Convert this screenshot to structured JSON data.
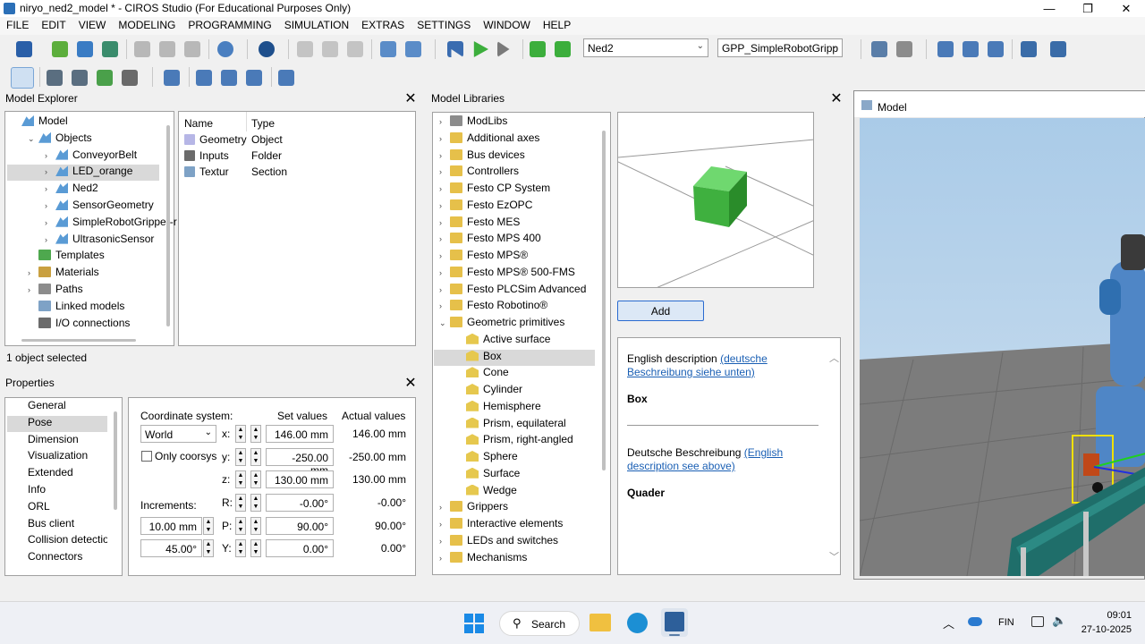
{
  "window": {
    "title": "niryo_ned2_model * - CIROS Studio (For Educational Purposes Only)",
    "min_symbol": "—",
    "max_symbol": "❐",
    "close_symbol": "✕"
  },
  "menu": [
    "FILE",
    "EDIT",
    "VIEW",
    "MODELING",
    "PROGRAMMING",
    "SIMULATION",
    "EXTRAS",
    "SETTINGS",
    "WINDOW",
    "HELP"
  ],
  "toolbar": {
    "robot_combo": "Ned2",
    "gripper_combo": "GPP_SimpleRobotGripp"
  },
  "model_explorer": {
    "title": "Model Explorer",
    "tree": [
      {
        "label": "Model",
        "icon": "model-icon",
        "level": 0,
        "expander": ""
      },
      {
        "label": "Objects",
        "icon": "objects-icon",
        "level": 1,
        "expander": "⌄"
      },
      {
        "label": "ConveyorBelt",
        "icon": "object-icon",
        "level": 2,
        "expander": "›"
      },
      {
        "label": "LED_orange",
        "icon": "object-icon",
        "level": 2,
        "expander": "›",
        "selected": true
      },
      {
        "label": "Ned2",
        "icon": "object-icon",
        "level": 2,
        "expander": "›"
      },
      {
        "label": "SensorGeometry",
        "icon": "object-icon",
        "level": 2,
        "expander": "›"
      },
      {
        "label": "SimpleRobotGripper-r",
        "icon": "object-icon",
        "level": 2,
        "expander": "›"
      },
      {
        "label": "UltrasonicSensor",
        "icon": "object-icon",
        "level": 2,
        "expander": "›"
      },
      {
        "label": "Templates",
        "icon": "templates-icon",
        "level": 1,
        "expander": ""
      },
      {
        "label": "Materials",
        "icon": "materials-icon",
        "level": 1,
        "expander": "›"
      },
      {
        "label": "Paths",
        "icon": "paths-icon",
        "level": 1,
        "expander": "›"
      },
      {
        "label": "Linked models",
        "icon": "linked-models-icon",
        "level": 1,
        "expander": ""
      },
      {
        "label": "I/O connections",
        "icon": "io-connections-icon",
        "level": 1,
        "expander": ""
      }
    ],
    "columns": [
      "Name",
      "Type"
    ],
    "rows": [
      {
        "name": "Geometry",
        "type": "Object"
      },
      {
        "name": "Inputs",
        "type": "Folder"
      },
      {
        "name": "Textur",
        "type": "Section"
      }
    ],
    "status": "1 object selected"
  },
  "properties": {
    "title": "Properties",
    "categories": [
      "General",
      "Pose",
      "Dimension",
      "Visualization",
      "Extended",
      "Info",
      "ORL",
      "Bus client",
      "Collision detection",
      "Connectors"
    ],
    "selected_category": "Pose",
    "coord_label": "Coordinate system:",
    "coord_value": "World",
    "only_coorsys": "Only coorsys",
    "set_values_header": "Set values",
    "actual_values_header": "Actual values",
    "increments_label": "Increments:",
    "inc_length": "10.00 mm",
    "inc_angle": "45.00°",
    "rows": [
      {
        "axis": "x:",
        "set": "146.00 mm",
        "actual": "146.00 mm"
      },
      {
        "axis": "y:",
        "set": "-250.00 mm",
        "actual": "-250.00 mm"
      },
      {
        "axis": "z:",
        "set": "130.00 mm",
        "actual": "130.00 mm"
      },
      {
        "axis": "R:",
        "set": "-0.00°",
        "actual": "-0.00°"
      },
      {
        "axis": "P:",
        "set": "90.00°",
        "actual": "90.00°"
      },
      {
        "axis": "Y:",
        "set": "0.00°",
        "actual": "0.00°"
      }
    ]
  },
  "model_libraries": {
    "title": "Model Libraries",
    "items": [
      {
        "label": "ModLibs",
        "level": 0,
        "expander": "›",
        "icon": "folder-icon"
      },
      {
        "label": "Additional axes",
        "level": 0,
        "expander": "›",
        "icon": "library-icon"
      },
      {
        "label": "Bus devices",
        "level": 0,
        "expander": "›",
        "icon": "library-icon"
      },
      {
        "label": "Controllers",
        "level": 0,
        "expander": "›",
        "icon": "library-icon"
      },
      {
        "label": "Festo CP System",
        "level": 0,
        "expander": "›",
        "icon": "library-icon"
      },
      {
        "label": "Festo EzOPC",
        "level": 0,
        "expander": "›",
        "icon": "library-icon"
      },
      {
        "label": "Festo MES",
        "level": 0,
        "expander": "›",
        "icon": "library-icon"
      },
      {
        "label": "Festo MPS 400",
        "level": 0,
        "expander": "›",
        "icon": "library-icon"
      },
      {
        "label": "Festo MPS®",
        "level": 0,
        "expander": "›",
        "icon": "library-icon"
      },
      {
        "label": "Festo MPS® 500-FMS",
        "level": 0,
        "expander": "›",
        "icon": "library-icon"
      },
      {
        "label": "Festo PLCSim Advanced",
        "level": 0,
        "expander": "›",
        "icon": "library-icon"
      },
      {
        "label": "Festo Robotino®",
        "level": 0,
        "expander": "›",
        "icon": "library-icon"
      },
      {
        "label": "Geometric primitives",
        "level": 0,
        "expander": "⌄",
        "icon": "library-icon"
      },
      {
        "label": "Active surface",
        "level": 1,
        "expander": "",
        "icon": "primitive-icon"
      },
      {
        "label": "Box",
        "level": 1,
        "expander": "",
        "icon": "primitive-icon",
        "selected": true
      },
      {
        "label": "Cone",
        "level": 1,
        "expander": "",
        "icon": "primitive-icon"
      },
      {
        "label": "Cylinder",
        "level": 1,
        "expander": "",
        "icon": "primitive-icon"
      },
      {
        "label": "Hemisphere",
        "level": 1,
        "expander": "",
        "icon": "primitive-icon"
      },
      {
        "label": "Prism, equilateral",
        "level": 1,
        "expander": "",
        "icon": "primitive-icon"
      },
      {
        "label": "Prism, right-angled",
        "level": 1,
        "expander": "",
        "icon": "primitive-icon"
      },
      {
        "label": "Sphere",
        "level": 1,
        "expander": "",
        "icon": "primitive-icon"
      },
      {
        "label": "Surface",
        "level": 1,
        "expander": "",
        "icon": "primitive-icon"
      },
      {
        "label": "Wedge",
        "level": 1,
        "expander": "",
        "icon": "primitive-icon"
      },
      {
        "label": "Grippers",
        "level": 0,
        "expander": "›",
        "icon": "library-icon"
      },
      {
        "label": "Interactive elements",
        "level": 0,
        "expander": "›",
        "icon": "library-icon"
      },
      {
        "label": "LEDs and switches",
        "level": 0,
        "expander": "›",
        "icon": "library-icon"
      },
      {
        "label": "Mechanisms",
        "level": 0,
        "expander": "›",
        "icon": "library-icon"
      }
    ],
    "add_button": "Add",
    "desc_en_label": "English description",
    "desc_en_link": "(deutsche Beschreibung siehe unten)",
    "desc_en_name": "Box",
    "desc_de_label": "Deutsche Beschreibung",
    "desc_de_link": "(English description see above)",
    "desc_de_name": "Quader"
  },
  "model_view": {
    "title": "Model"
  },
  "taskbar": {
    "search": "Search",
    "lang": "FIN",
    "time": "09:01",
    "date": "27-10-2025"
  }
}
